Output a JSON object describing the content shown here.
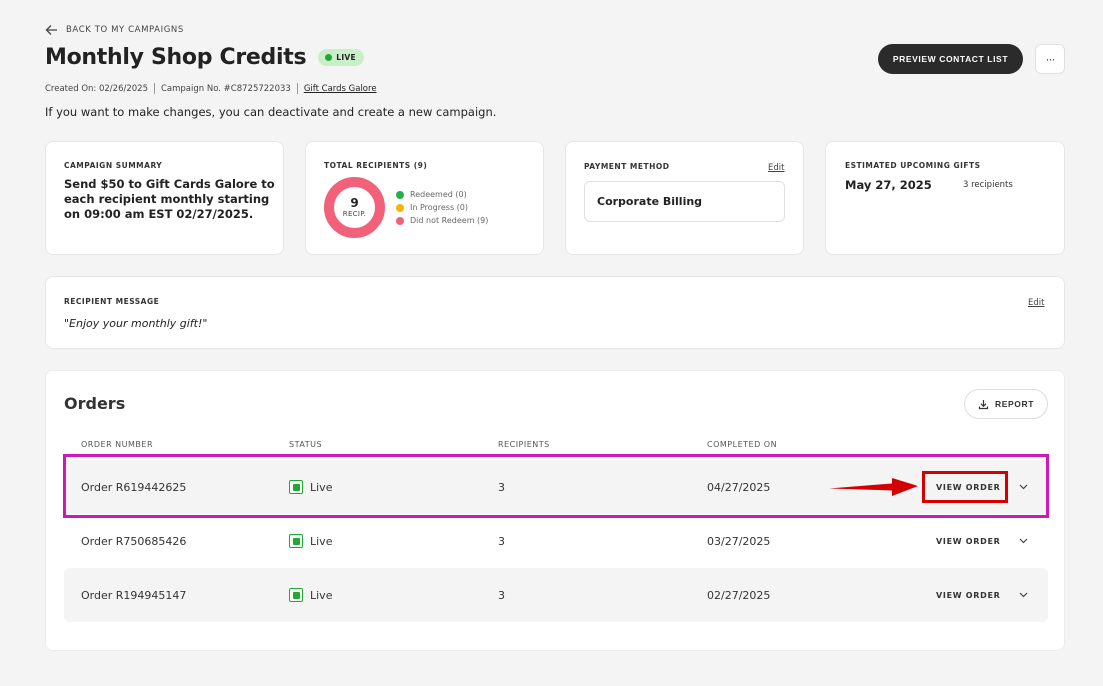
{
  "back_link": "BACK TO MY CAMPAIGNS",
  "campaign": {
    "title": "Monthly Shop Credits",
    "status": "LIVE",
    "created_on": "Created On: 02/26/2025",
    "campaign_no": "Campaign No. #C8725722033",
    "brand": "Gift Cards Galore",
    "subtitle": "If you want to make changes, you can deactivate and create a new campaign."
  },
  "header_actions": {
    "preview_label": "PREVIEW CONTACT LIST",
    "more_label": "···"
  },
  "summary_card": {
    "label": "CAMPAIGN SUMMARY",
    "text": "Send $50 to Gift Cards Galore to each recipient monthly starting on 09:00 am EST 02/27/2025."
  },
  "recipients_card": {
    "label": "TOTAL RECIPIENTS (9)",
    "donut_value": "9",
    "donut_unit": "RECIP.",
    "legend": [
      {
        "label": "Redeemed (0)",
        "color": "#22b14c"
      },
      {
        "label": "In Progress (0)",
        "color": "#f2b705"
      },
      {
        "label": "Did not Redeem (9)",
        "color": "#f2617a"
      }
    ]
  },
  "payment_card": {
    "label": "PAYMENT METHOD",
    "edit": "Edit",
    "method": "Corporate Billing"
  },
  "upcoming_card": {
    "label": "ESTIMATED UPCOMING GIFTS",
    "date": "May 27, 2025",
    "recipients": "3 recipients"
  },
  "message_card": {
    "label": "RECIPIENT MESSAGE",
    "edit": "Edit",
    "message": "\"Enjoy your monthly gift!\""
  },
  "orders": {
    "title": "Orders",
    "report_label": "REPORT",
    "columns": [
      "ORDER NUMBER",
      "STATUS",
      "RECIPIENTS",
      "COMPLETED ON"
    ],
    "view_label": "VIEW ORDER",
    "rows": [
      {
        "order": "Order R619442625",
        "status": "Live",
        "recipients": "3",
        "completed": "04/27/2025"
      },
      {
        "order": "Order R750685426",
        "status": "Live",
        "recipients": "3",
        "completed": "03/27/2025"
      },
      {
        "order": "Order R194945147",
        "status": "Live",
        "recipients": "3",
        "completed": "02/27/2025"
      }
    ]
  },
  "annotation_colors": {
    "row_highlight": "#cc19b8",
    "button_highlight": "#d40000",
    "arrow": "#d40000"
  }
}
